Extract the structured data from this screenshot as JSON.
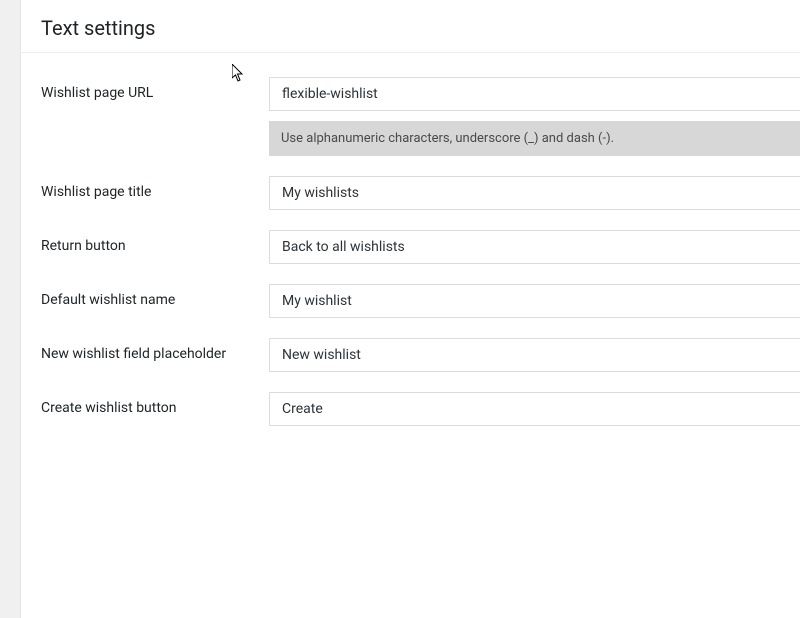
{
  "section_title": "Text settings",
  "fields": {
    "url": {
      "label": "Wishlist page URL",
      "value": "flexible-wishlist",
      "help": "Use alphanumeric characters, underscore (_) and dash (-)."
    },
    "title": {
      "label": "Wishlist page title",
      "value": "My wishlists"
    },
    "return": {
      "label": "Return button",
      "value": "Back to all wishlists"
    },
    "default_name": {
      "label": "Default wishlist name",
      "value": "My wishlist"
    },
    "placeholder": {
      "label": "New wishlist field placeholder",
      "value": "New wishlist"
    },
    "create": {
      "label": "Create wishlist button",
      "value": "Create"
    }
  }
}
